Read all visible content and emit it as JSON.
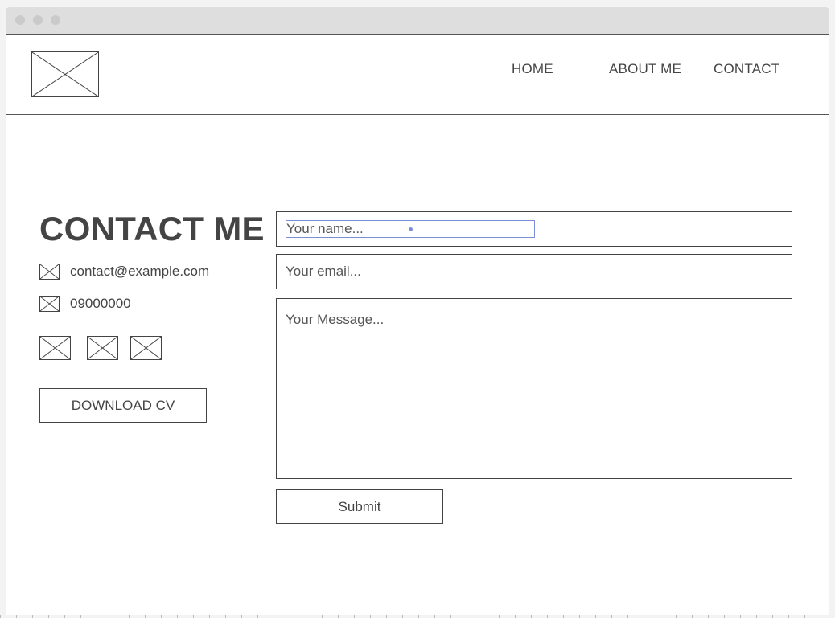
{
  "nav": {
    "items": [
      {
        "label": "HOME"
      },
      {
        "label": "ABOUT ME"
      },
      {
        "label": "CONTACT"
      }
    ]
  },
  "contact": {
    "title": "CONTACT ME",
    "email": "contact@example.com",
    "phone": "09000000",
    "download_label": "DOWNLOAD CV"
  },
  "form": {
    "name_placeholder": "Your name...",
    "email_placeholder": "Your email...",
    "message_placeholder": "Your Message...",
    "submit_label": "Submit"
  },
  "colors": {
    "titlebar": "#dedede",
    "text": "#444444",
    "focus_border": "#7b8fd8"
  },
  "icons": {
    "logo": "image-placeholder-icon",
    "email": "image-placeholder-icon",
    "phone": "image-placeholder-icon",
    "social": [
      "image-placeholder-icon",
      "image-placeholder-icon",
      "image-placeholder-icon"
    ]
  }
}
